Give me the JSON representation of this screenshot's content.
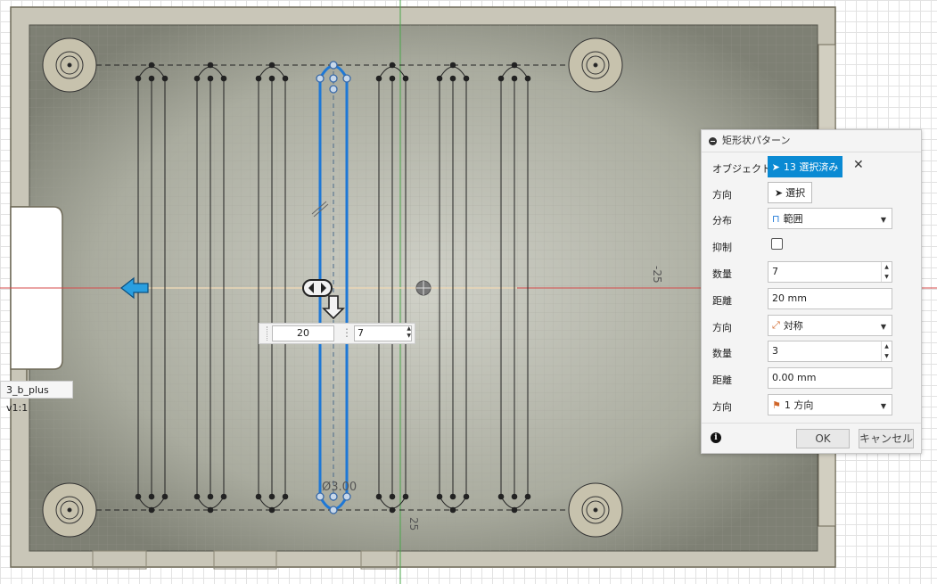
{
  "viewport": {
    "component_label": "3_b_plus v1:1",
    "dim_diameter": "Ø3.00",
    "dim_side_neg": "-25",
    "dim_side_pos": "25"
  },
  "mini_input": {
    "distance_value": "20",
    "count_value": "7"
  },
  "dialog": {
    "title": "矩形状パターン",
    "rows": {
      "object": {
        "label": "オブジェクト",
        "button": "13 選択済み"
      },
      "direction_select": {
        "label": "方向",
        "button": "選択"
      },
      "distribution": {
        "label": "分布",
        "value": "範囲"
      },
      "suppress": {
        "label": "抑制"
      },
      "quantity1": {
        "label": "数量",
        "value": "7"
      },
      "distance1": {
        "label": "距離",
        "value": "20 mm"
      },
      "direction_type": {
        "label": "方向",
        "value": "対称"
      },
      "quantity2": {
        "label": "数量",
        "value": "3"
      },
      "distance2": {
        "label": "距離",
        "value": "0.00 mm"
      },
      "direction_type2": {
        "label": "方向",
        "value": "1 方向"
      }
    },
    "ok_label": "OK",
    "cancel_label": "キャンセル"
  }
}
